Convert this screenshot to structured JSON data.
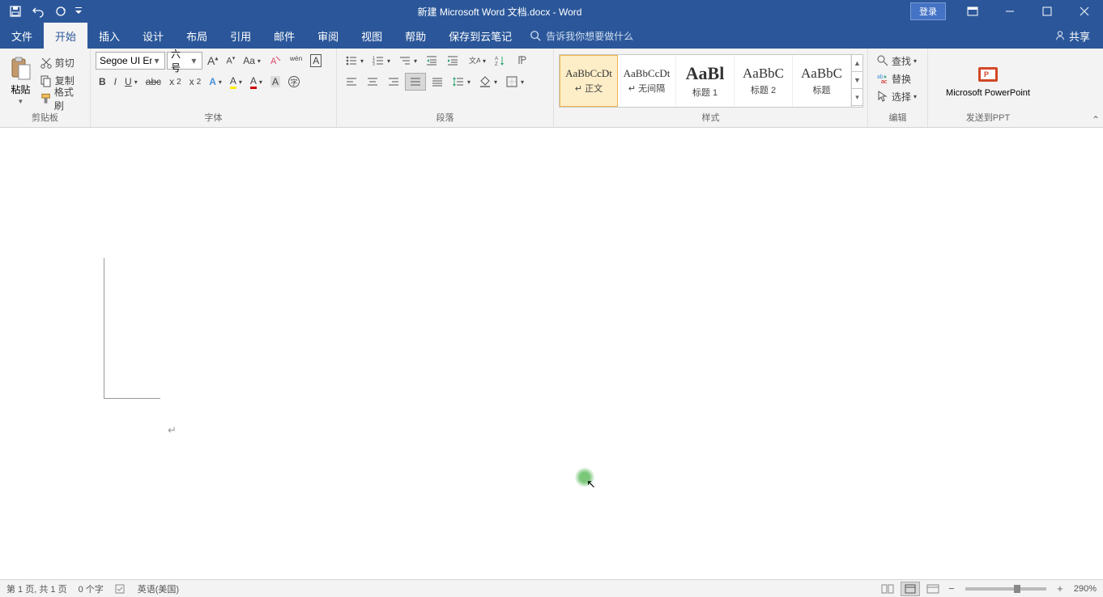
{
  "title": "新建 Microsoft Word 文档.docx - Word",
  "login": "登录",
  "tabs": {
    "file": "文件",
    "home": "开始",
    "insert": "插入",
    "design": "设计",
    "layout": "布局",
    "references": "引用",
    "mail": "邮件",
    "review": "审阅",
    "view": "视图",
    "help": "帮助",
    "cloud": "保存到云笔记"
  },
  "tellme": "告诉我你想要做什么",
  "share": "共享",
  "clipboard": {
    "paste": "粘贴",
    "cut": "剪切",
    "copy": "复制",
    "formatPainter": "格式刷",
    "label": "剪贴板"
  },
  "font": {
    "name": "Segoe UI Em",
    "size": "六号",
    "label": "字体"
  },
  "paragraph": {
    "label": "段落"
  },
  "styles": {
    "label": "样式",
    "items": [
      {
        "preview": "AaBbCcDt",
        "name": "正文",
        "previewSize": "13px"
      },
      {
        "preview": "AaBbCcDt",
        "name": "无间隔",
        "previewSize": "13px"
      },
      {
        "preview": "AaBl",
        "name": "标题 1",
        "previewSize": "22px"
      },
      {
        "preview": "AaBbC",
        "name": "标题 2",
        "previewSize": "17px"
      },
      {
        "preview": "AaBbC",
        "name": "标题",
        "previewSize": "17px"
      }
    ]
  },
  "editing": {
    "find": "查找",
    "replace": "替换",
    "select": "选择",
    "label": "编辑"
  },
  "ppt": {
    "label": "Microsoft PowerPoint",
    "group": "发送到PPT"
  },
  "status": {
    "page": "第 1 页, 共 1 页",
    "words": "0 个字",
    "lang": "英语(美国)",
    "zoom": "290%"
  }
}
